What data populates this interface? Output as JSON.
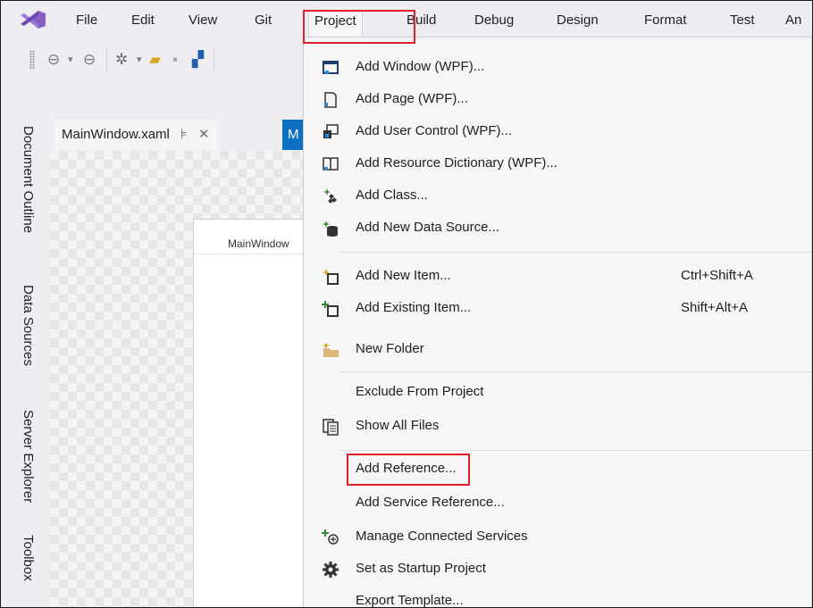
{
  "menubar": {
    "items": [
      "File",
      "Edit",
      "View",
      "Git",
      "Project",
      "Build",
      "Debug",
      "Design",
      "Format",
      "Test",
      "An"
    ]
  },
  "document_tab": {
    "title": "MainWindow.xaml",
    "pin_glyph": "⊧",
    "close_glyph": "✕",
    "second_tab": "M"
  },
  "designer": {
    "preview_title": "MainWindow"
  },
  "side_tabs": [
    "Document Outline",
    "Data Sources",
    "Server Explorer",
    "Toolbox"
  ],
  "project_menu": {
    "items": [
      {
        "label": "Add Window (WPF)...",
        "icon": "window-icon",
        "shortcut": ""
      },
      {
        "label": "Add Page (WPF)...",
        "icon": "page-icon",
        "shortcut": ""
      },
      {
        "label": "Add User Control (WPF)...",
        "icon": "user-control-icon",
        "shortcut": ""
      },
      {
        "label": "Add Resource Dictionary (WPF)...",
        "icon": "resource-dictionary-icon",
        "shortcut": ""
      },
      {
        "label": "Add Class...",
        "icon": "class-icon",
        "shortcut": ""
      },
      {
        "label": "Add New Data Source...",
        "icon": "data-source-icon",
        "shortcut": ""
      },
      {
        "label": "Add New Item...",
        "icon": "new-item-icon",
        "shortcut": "Ctrl+Shift+A"
      },
      {
        "label": "Add Existing Item...",
        "icon": "existing-item-icon",
        "shortcut": "Shift+Alt+A"
      },
      {
        "label": "New Folder",
        "icon": "folder-icon",
        "shortcut": ""
      },
      {
        "label": "Exclude From Project",
        "icon": "",
        "shortcut": ""
      },
      {
        "label": "Show All Files",
        "icon": "show-all-files-icon",
        "shortcut": ""
      },
      {
        "label": "Add Reference...",
        "icon": "",
        "shortcut": ""
      },
      {
        "label": "Add Service Reference...",
        "icon": "",
        "shortcut": ""
      },
      {
        "label": "Manage Connected Services",
        "icon": "connected-services-icon",
        "shortcut": ""
      },
      {
        "label": "Set as Startup Project",
        "icon": "gear-icon",
        "shortcut": ""
      },
      {
        "label": "Export Template...",
        "icon": "",
        "shortcut": ""
      }
    ]
  },
  "colors": {
    "highlight": "#e01e2a",
    "vs_purple": "#865fc5",
    "accent_blue": "#0e70c0"
  }
}
